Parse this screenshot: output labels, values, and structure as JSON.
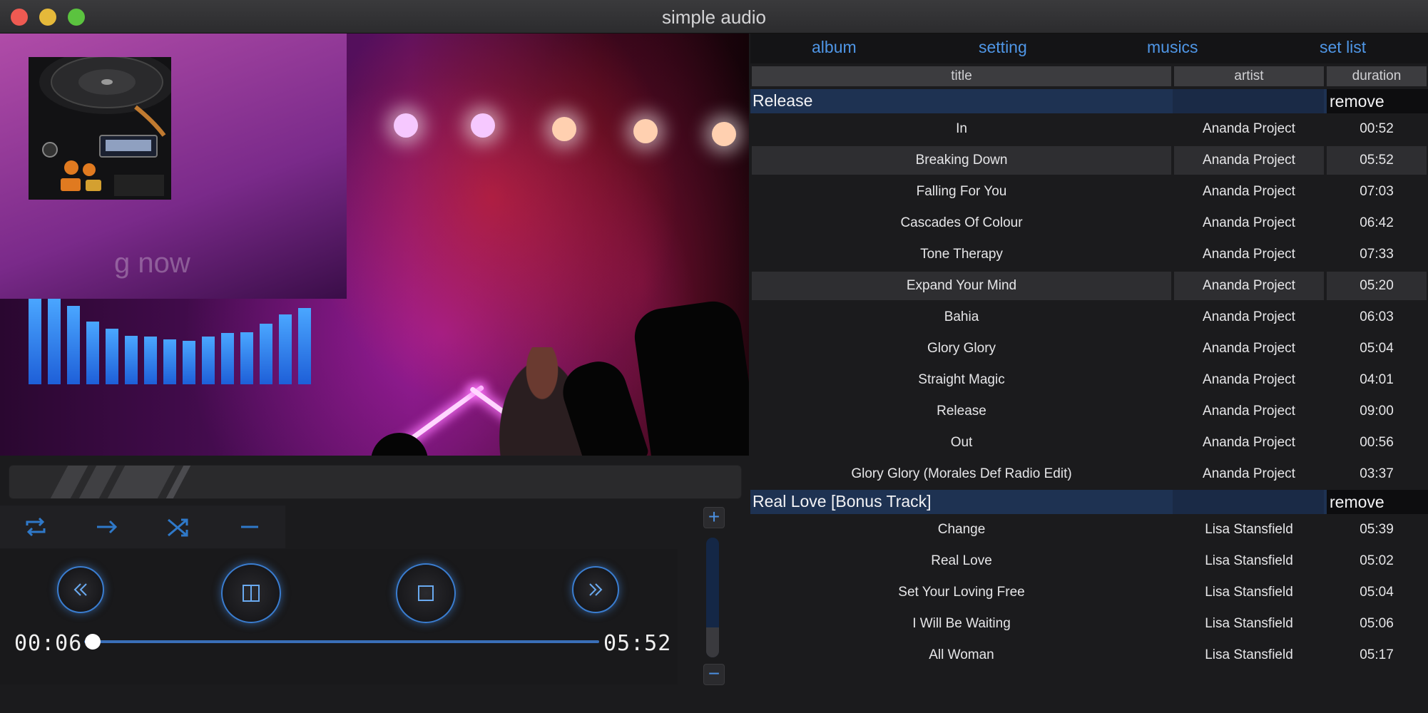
{
  "window": {
    "title": "simple audio"
  },
  "overlay": {
    "screen_text": "g now"
  },
  "nav": {
    "tabs": [
      "album",
      "setting",
      "musics",
      "set list"
    ]
  },
  "columns": {
    "title": "title",
    "artist": "artist",
    "duration": "duration"
  },
  "playlist": {
    "groups": [
      {
        "name": "Release",
        "remove_label": "remove",
        "tracks": [
          {
            "title": "In",
            "artist": "Ananda Project",
            "duration": "00:52"
          },
          {
            "title": "Breaking Down",
            "artist": "Ananda Project",
            "duration": "05:52"
          },
          {
            "title": "Falling For You",
            "artist": "Ananda Project",
            "duration": "07:03"
          },
          {
            "title": "Cascades Of Colour",
            "artist": "Ananda Project",
            "duration": "06:42"
          },
          {
            "title": "Tone Therapy",
            "artist": "Ananda Project",
            "duration": "07:33"
          },
          {
            "title": "Expand Your Mind",
            "artist": "Ananda Project",
            "duration": "05:20"
          },
          {
            "title": "Bahia",
            "artist": "Ananda Project",
            "duration": "06:03"
          },
          {
            "title": "Glory Glory",
            "artist": "Ananda Project",
            "duration": "05:04"
          },
          {
            "title": "Straight Magic",
            "artist": "Ananda Project",
            "duration": "04:01"
          },
          {
            "title": "Release",
            "artist": "Ananda Project",
            "duration": "09:00"
          },
          {
            "title": "Out",
            "artist": "Ananda Project",
            "duration": "00:56"
          },
          {
            "title": "Glory Glory (Morales Def Radio Edit)",
            "artist": "Ananda Project",
            "duration": "03:37"
          }
        ]
      },
      {
        "name": "Real Love [Bonus Track]",
        "remove_label": "remove",
        "tracks": [
          {
            "title": "Change",
            "artist": "Lisa Stansfield",
            "duration": "05:39"
          },
          {
            "title": "Real Love",
            "artist": "Lisa Stansfield",
            "duration": "05:02"
          },
          {
            "title": "Set Your Loving Free",
            "artist": "Lisa Stansfield",
            "duration": "05:04"
          },
          {
            "title": "I Will Be Waiting",
            "artist": "Lisa Stansfield",
            "duration": "05:06"
          },
          {
            "title": "All Woman",
            "artist": "Lisa Stansfield",
            "duration": "05:17"
          }
        ]
      }
    ],
    "highlighted_tracks": [
      "Breaking Down",
      "Expand Your Mind"
    ]
  },
  "player": {
    "elapsed": "00:06",
    "total": "05:52",
    "progress_fraction": 0.017,
    "volume_fraction": 0.75,
    "equalizer_levels": [
      0.98,
      0.98,
      0.9,
      0.72,
      0.64,
      0.56,
      0.55,
      0.52,
      0.5,
      0.55,
      0.59,
      0.6,
      0.7,
      0.8,
      0.88
    ]
  },
  "icons": {
    "modes": [
      "repeat-icon",
      "next-arrow-icon",
      "shuffle-icon",
      "minus-icon"
    ],
    "transport": [
      "rewind-icon",
      "pause-icon",
      "stop-icon",
      "fast-forward-icon"
    ]
  },
  "colors": {
    "accent": "#4f96e6",
    "group_header": "#1e3252",
    "selected_row": "#2e2e31"
  }
}
